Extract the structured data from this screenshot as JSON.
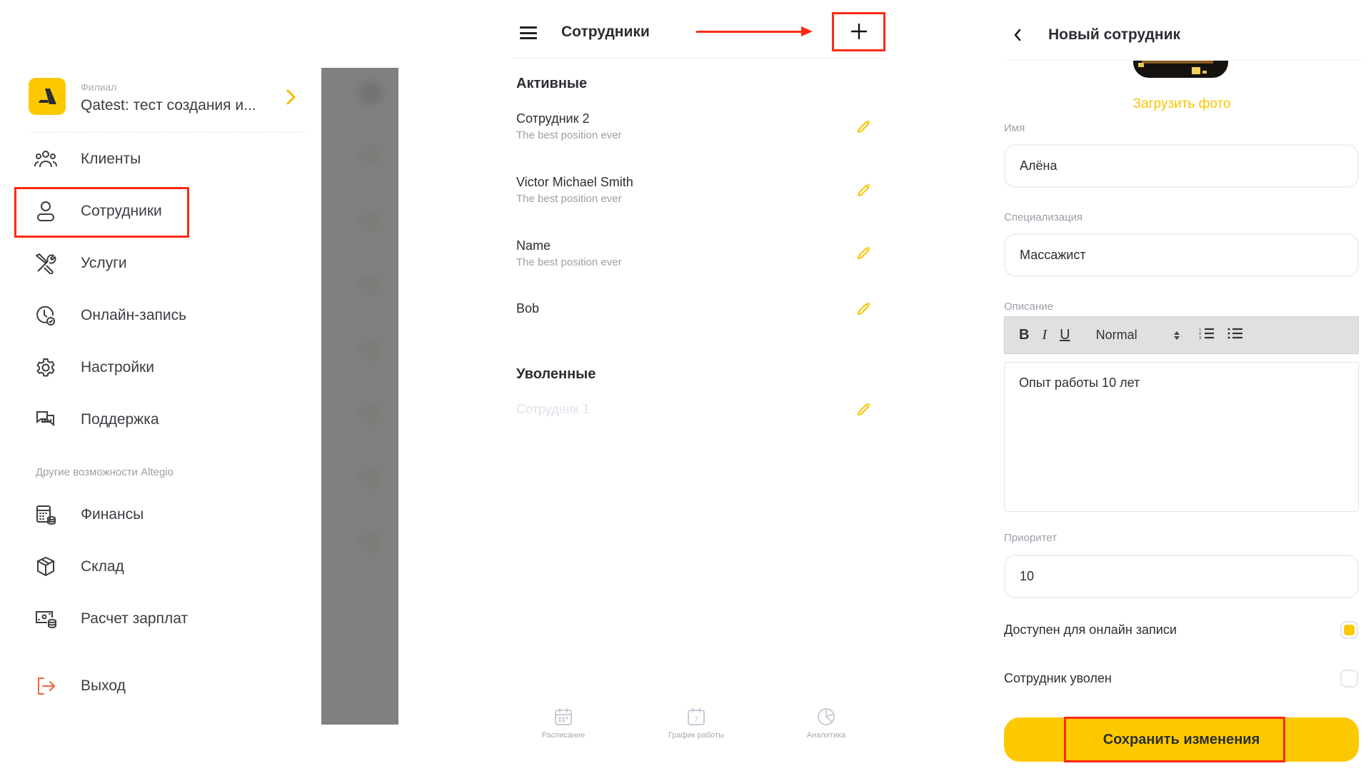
{
  "side_menu": {
    "branch_caption": "Филиал",
    "branch_name": "Qatest: тест создания и...",
    "items": [
      {
        "label": "Клиенты",
        "icon": "clients-icon"
      },
      {
        "label": "Сотрудники",
        "icon": "user-icon"
      },
      {
        "label": "Услуги",
        "icon": "tools-icon"
      },
      {
        "label": "Онлайн-запись",
        "icon": "online-booking-icon"
      },
      {
        "label": "Настройки",
        "icon": "gear-icon"
      },
      {
        "label": "Поддержка",
        "icon": "chat-icon"
      }
    ],
    "other_caption": "Другие возможности Altegio",
    "other_items": [
      {
        "label": "Финансы",
        "icon": "finance-icon"
      },
      {
        "label": "Склад",
        "icon": "box-icon"
      },
      {
        "label": "Расчет зарплат",
        "icon": "payroll-icon"
      }
    ],
    "logout_label": "Выход",
    "accent_color": "#fcc900",
    "logout_color": "#f0643c"
  },
  "staff_list": {
    "title": "Сотрудники",
    "add_label": "+",
    "active_title": "Активные",
    "active": [
      {
        "name": "Сотрудник 2",
        "position": "The best position ever"
      },
      {
        "name": "Victor Michael Smith",
        "position": "The best position ever"
      },
      {
        "name": "Name",
        "position": "The best position ever"
      },
      {
        "name": "Bob",
        "position": ""
      }
    ],
    "fired_title": "Уволенные",
    "fired": [
      {
        "name": "Сотрудник 1"
      }
    ],
    "tabs": [
      {
        "label": "Расписание",
        "icon": "calendar-icon"
      },
      {
        "label": "График работы",
        "icon": "calendar-7-icon",
        "glyph": "7"
      },
      {
        "label": "Аналитика",
        "icon": "pie-chart-icon"
      }
    ]
  },
  "new_employee": {
    "title": "Новый сотрудник",
    "upload_photo": "Загрузить фото",
    "name_label": "Имя",
    "name_value": "Алёна",
    "spec_label": "Специализация",
    "spec_value": "Массажист",
    "desc_label": "Описание",
    "toolbar": {
      "bold": "B",
      "italic": "I",
      "underline": "U",
      "format": "Normal"
    },
    "desc_value": "Опыт работы 10 лет",
    "priority_label": "Приоритет",
    "priority_value": "10",
    "online_label": "Доступен для онлайн записи",
    "online_checked": true,
    "fired_label": "Сотрудник уволен",
    "fired_checked": false,
    "save_label": "Сохранить изменения",
    "accent_color": "#fcc900"
  },
  "annotations": {
    "highlight_color": "#ff2a14"
  }
}
